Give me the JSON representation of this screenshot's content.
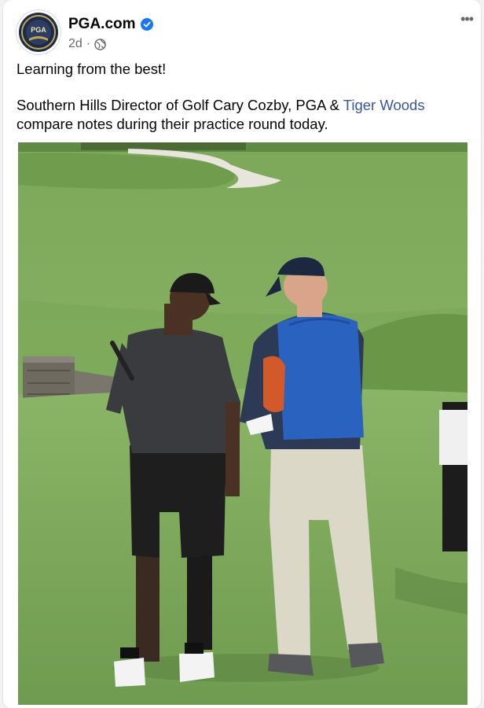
{
  "post": {
    "author": "PGA.com",
    "time": "2d",
    "separator": "·",
    "verified": true,
    "privacy_icon": "globe-icon",
    "more_icon": "more-options-icon",
    "more_label": "•••",
    "text_line1": "Learning from the best!",
    "text_line2_prefix": "Southern Hills Director of Golf Cary Cozby, PGA & ",
    "text_line2_link": "Tiger Woods",
    "text_line3": "compare notes during their practice round today.",
    "avatar_logo_text": "PGA"
  },
  "colors": {
    "link": "#385898",
    "verified_badge": "#1877f2",
    "meta_text": "#65676b"
  }
}
